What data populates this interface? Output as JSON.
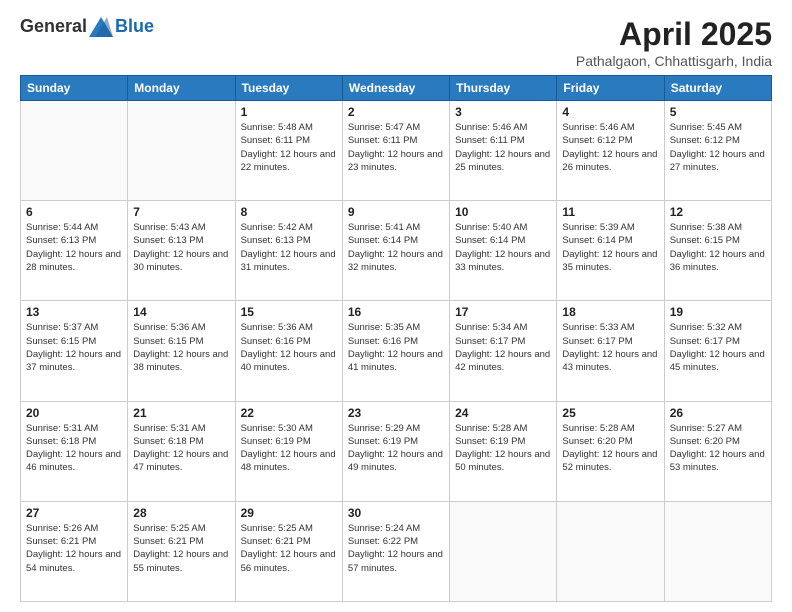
{
  "logo": {
    "text_general": "General",
    "text_blue": "Blue"
  },
  "title": {
    "main": "April 2025",
    "sub": "Pathalgaon, Chhattisgarh, India"
  },
  "weekdays": [
    "Sunday",
    "Monday",
    "Tuesday",
    "Wednesday",
    "Thursday",
    "Friday",
    "Saturday"
  ],
  "weeks": [
    [
      {
        "day": "",
        "sunrise": "",
        "sunset": "",
        "daylight": ""
      },
      {
        "day": "",
        "sunrise": "",
        "sunset": "",
        "daylight": ""
      },
      {
        "day": "1",
        "sunrise": "Sunrise: 5:48 AM",
        "sunset": "Sunset: 6:11 PM",
        "daylight": "Daylight: 12 hours and 22 minutes."
      },
      {
        "day": "2",
        "sunrise": "Sunrise: 5:47 AM",
        "sunset": "Sunset: 6:11 PM",
        "daylight": "Daylight: 12 hours and 23 minutes."
      },
      {
        "day": "3",
        "sunrise": "Sunrise: 5:46 AM",
        "sunset": "Sunset: 6:11 PM",
        "daylight": "Daylight: 12 hours and 25 minutes."
      },
      {
        "day": "4",
        "sunrise": "Sunrise: 5:46 AM",
        "sunset": "Sunset: 6:12 PM",
        "daylight": "Daylight: 12 hours and 26 minutes."
      },
      {
        "day": "5",
        "sunrise": "Sunrise: 5:45 AM",
        "sunset": "Sunset: 6:12 PM",
        "daylight": "Daylight: 12 hours and 27 minutes."
      }
    ],
    [
      {
        "day": "6",
        "sunrise": "Sunrise: 5:44 AM",
        "sunset": "Sunset: 6:13 PM",
        "daylight": "Daylight: 12 hours and 28 minutes."
      },
      {
        "day": "7",
        "sunrise": "Sunrise: 5:43 AM",
        "sunset": "Sunset: 6:13 PM",
        "daylight": "Daylight: 12 hours and 30 minutes."
      },
      {
        "day": "8",
        "sunrise": "Sunrise: 5:42 AM",
        "sunset": "Sunset: 6:13 PM",
        "daylight": "Daylight: 12 hours and 31 minutes."
      },
      {
        "day": "9",
        "sunrise": "Sunrise: 5:41 AM",
        "sunset": "Sunset: 6:14 PM",
        "daylight": "Daylight: 12 hours and 32 minutes."
      },
      {
        "day": "10",
        "sunrise": "Sunrise: 5:40 AM",
        "sunset": "Sunset: 6:14 PM",
        "daylight": "Daylight: 12 hours and 33 minutes."
      },
      {
        "day": "11",
        "sunrise": "Sunrise: 5:39 AM",
        "sunset": "Sunset: 6:14 PM",
        "daylight": "Daylight: 12 hours and 35 minutes."
      },
      {
        "day": "12",
        "sunrise": "Sunrise: 5:38 AM",
        "sunset": "Sunset: 6:15 PM",
        "daylight": "Daylight: 12 hours and 36 minutes."
      }
    ],
    [
      {
        "day": "13",
        "sunrise": "Sunrise: 5:37 AM",
        "sunset": "Sunset: 6:15 PM",
        "daylight": "Daylight: 12 hours and 37 minutes."
      },
      {
        "day": "14",
        "sunrise": "Sunrise: 5:36 AM",
        "sunset": "Sunset: 6:15 PM",
        "daylight": "Daylight: 12 hours and 38 minutes."
      },
      {
        "day": "15",
        "sunrise": "Sunrise: 5:36 AM",
        "sunset": "Sunset: 6:16 PM",
        "daylight": "Daylight: 12 hours and 40 minutes."
      },
      {
        "day": "16",
        "sunrise": "Sunrise: 5:35 AM",
        "sunset": "Sunset: 6:16 PM",
        "daylight": "Daylight: 12 hours and 41 minutes."
      },
      {
        "day": "17",
        "sunrise": "Sunrise: 5:34 AM",
        "sunset": "Sunset: 6:17 PM",
        "daylight": "Daylight: 12 hours and 42 minutes."
      },
      {
        "day": "18",
        "sunrise": "Sunrise: 5:33 AM",
        "sunset": "Sunset: 6:17 PM",
        "daylight": "Daylight: 12 hours and 43 minutes."
      },
      {
        "day": "19",
        "sunrise": "Sunrise: 5:32 AM",
        "sunset": "Sunset: 6:17 PM",
        "daylight": "Daylight: 12 hours and 45 minutes."
      }
    ],
    [
      {
        "day": "20",
        "sunrise": "Sunrise: 5:31 AM",
        "sunset": "Sunset: 6:18 PM",
        "daylight": "Daylight: 12 hours and 46 minutes."
      },
      {
        "day": "21",
        "sunrise": "Sunrise: 5:31 AM",
        "sunset": "Sunset: 6:18 PM",
        "daylight": "Daylight: 12 hours and 47 minutes."
      },
      {
        "day": "22",
        "sunrise": "Sunrise: 5:30 AM",
        "sunset": "Sunset: 6:19 PM",
        "daylight": "Daylight: 12 hours and 48 minutes."
      },
      {
        "day": "23",
        "sunrise": "Sunrise: 5:29 AM",
        "sunset": "Sunset: 6:19 PM",
        "daylight": "Daylight: 12 hours and 49 minutes."
      },
      {
        "day": "24",
        "sunrise": "Sunrise: 5:28 AM",
        "sunset": "Sunset: 6:19 PM",
        "daylight": "Daylight: 12 hours and 50 minutes."
      },
      {
        "day": "25",
        "sunrise": "Sunrise: 5:28 AM",
        "sunset": "Sunset: 6:20 PM",
        "daylight": "Daylight: 12 hours and 52 minutes."
      },
      {
        "day": "26",
        "sunrise": "Sunrise: 5:27 AM",
        "sunset": "Sunset: 6:20 PM",
        "daylight": "Daylight: 12 hours and 53 minutes."
      }
    ],
    [
      {
        "day": "27",
        "sunrise": "Sunrise: 5:26 AM",
        "sunset": "Sunset: 6:21 PM",
        "daylight": "Daylight: 12 hours and 54 minutes."
      },
      {
        "day": "28",
        "sunrise": "Sunrise: 5:25 AM",
        "sunset": "Sunset: 6:21 PM",
        "daylight": "Daylight: 12 hours and 55 minutes."
      },
      {
        "day": "29",
        "sunrise": "Sunrise: 5:25 AM",
        "sunset": "Sunset: 6:21 PM",
        "daylight": "Daylight: 12 hours and 56 minutes."
      },
      {
        "day": "30",
        "sunrise": "Sunrise: 5:24 AM",
        "sunset": "Sunset: 6:22 PM",
        "daylight": "Daylight: 12 hours and 57 minutes."
      },
      {
        "day": "",
        "sunrise": "",
        "sunset": "",
        "daylight": ""
      },
      {
        "day": "",
        "sunrise": "",
        "sunset": "",
        "daylight": ""
      },
      {
        "day": "",
        "sunrise": "",
        "sunset": "",
        "daylight": ""
      }
    ]
  ]
}
